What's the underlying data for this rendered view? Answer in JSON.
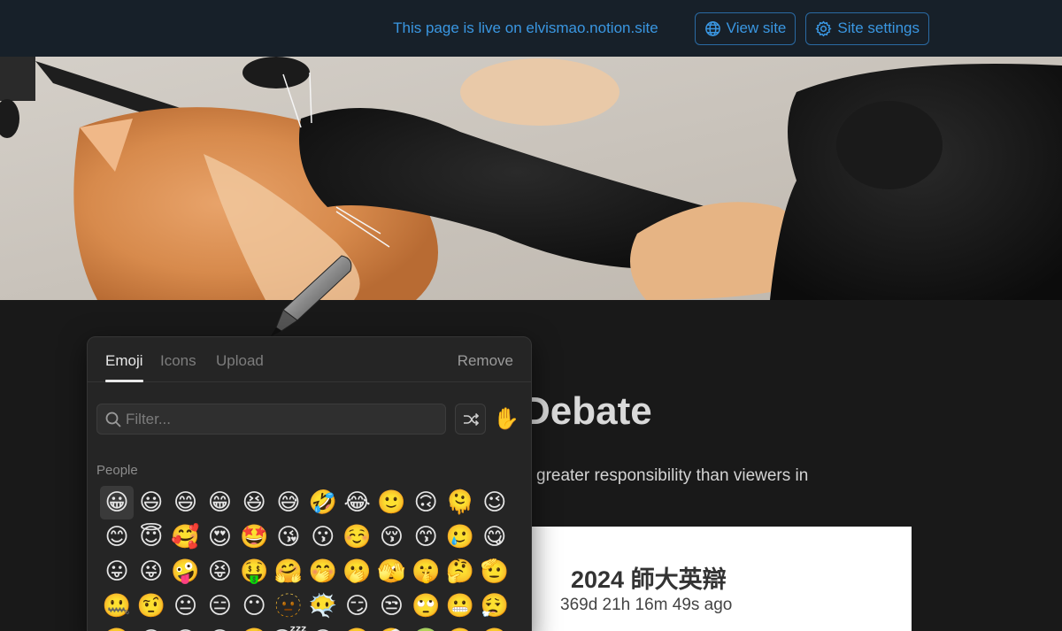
{
  "topbar": {
    "live_text": "This page is live on elvismao.notion.site",
    "view_site_label": "View site",
    "site_settings_label": "Site settings"
  },
  "cover": {
    "description": "cat cover image"
  },
  "page": {
    "title": "Debate",
    "description": "greater responsibility than viewers in",
    "embed_title": "2024 師大英辯",
    "embed_count": "369d 21h 16m 49s ago"
  },
  "picker": {
    "tabs": [
      {
        "label": "Emoji"
      },
      {
        "label": "Icons"
      },
      {
        "label": "Upload"
      }
    ],
    "remove_label": "Remove",
    "filter_placeholder": "Filter...",
    "random_emoji": "✋",
    "section_label": "People",
    "emojis": [
      "😀",
      "😃",
      "😄",
      "😁",
      "😆",
      "😅",
      "🤣",
      "😂",
      "🙂",
      "🙃",
      "🫠",
      "😉",
      "😊",
      "😇",
      "🥰",
      "😍",
      "🤩",
      "😘",
      "😗",
      "☺️",
      "😚",
      "😙",
      "🥲",
      "😋",
      "😛",
      "😜",
      "🤪",
      "😝",
      "🤑",
      "🤗",
      "🤭",
      "🫢",
      "🫣",
      "🤫",
      "🤔",
      "🫡",
      "🤐",
      "🤨",
      "😐",
      "😑",
      "😶",
      "🫥",
      "😶‍🌫️",
      "😏",
      "😒",
      "🙄",
      "😬",
      "😮‍💨",
      "🤥",
      "😌",
      "😔",
      "😪",
      "🤤",
      "😴",
      "😷",
      "🤒",
      "🤕",
      "🤢",
      "🤮",
      "🤧"
    ]
  },
  "colors": {
    "topbar_bg": "#172029",
    "accent_blue": "#3a97e2",
    "page_bg": "#191919",
    "picker_bg": "#252525"
  }
}
